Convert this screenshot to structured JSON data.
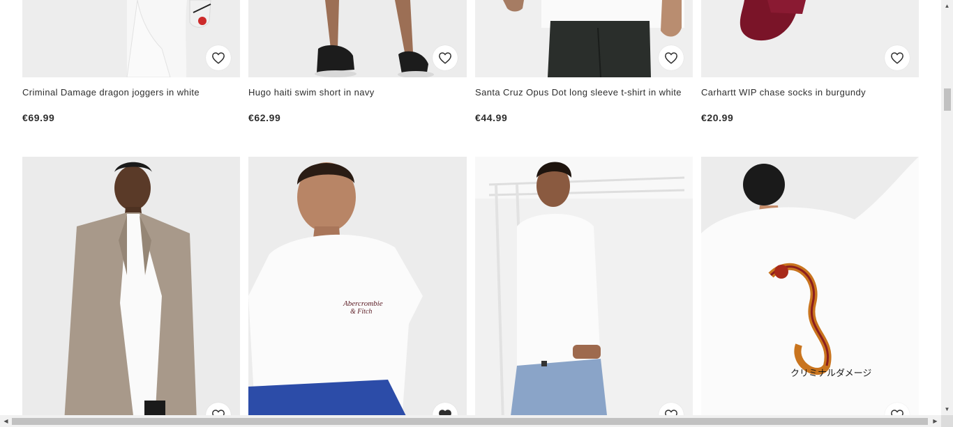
{
  "products_row_1": [
    {
      "title": "Criminal Damage dragon joggers in white",
      "price": "€69.99"
    },
    {
      "title": "Hugo haiti swim short in navy",
      "price": "€62.99"
    },
    {
      "title": "Santa Cruz Opus Dot long sleeve t-shirt in white",
      "price": "€44.99"
    },
    {
      "title": "Carhartt WIP chase socks in burgundy",
      "price": "€20.99"
    }
  ],
  "products_row_2_images": [
    {
      "description_icon": "model-in-beige-blazer"
    },
    {
      "description_icon": "model-in-white-tshirt"
    },
    {
      "description_icon": "model-in-white-long-sleeve"
    },
    {
      "description_icon": "model-in-white-dragon-hoodie"
    }
  ],
  "tshirt_print": "Abercrombie & Fitch",
  "hoodie_print": "クリミナルダメージ",
  "colors": {
    "accent_text": "#2d2d2d",
    "burgundy": "#7a1428",
    "blazer": "#a8998a",
    "navy": "#1e2a3a"
  }
}
